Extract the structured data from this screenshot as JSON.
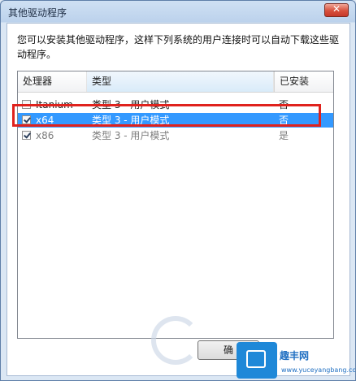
{
  "window": {
    "title": "其他驱动程序",
    "close_label": "✕"
  },
  "description": "您可以安装其他驱动程序，这样下列系统的用户连接时可以自动下载这些驱动程序。",
  "list": {
    "columns": {
      "processor": "处理器",
      "type": "类型",
      "installed": "已安装"
    },
    "rows": [
      {
        "checked": false,
        "processor": "Itanium",
        "type": "类型 3 - 用户模式",
        "installed": "否",
        "selected": false,
        "disabled": false
      },
      {
        "checked": true,
        "processor": "x64",
        "type": "类型 3 - 用户模式",
        "installed": "否",
        "selected": true,
        "disabled": false
      },
      {
        "checked": true,
        "processor": "x86",
        "type": "类型 3 - 用户模式",
        "installed": "是",
        "selected": false,
        "disabled": true
      }
    ]
  },
  "buttons": {
    "ok_label": "确"
  },
  "watermark": {
    "site_name": "路由器",
    "brand": "趣丰网",
    "url": "www.yuceyangbang.com"
  },
  "colors": {
    "selection": "#3399ff",
    "highlight_border": "#e0221d"
  }
}
